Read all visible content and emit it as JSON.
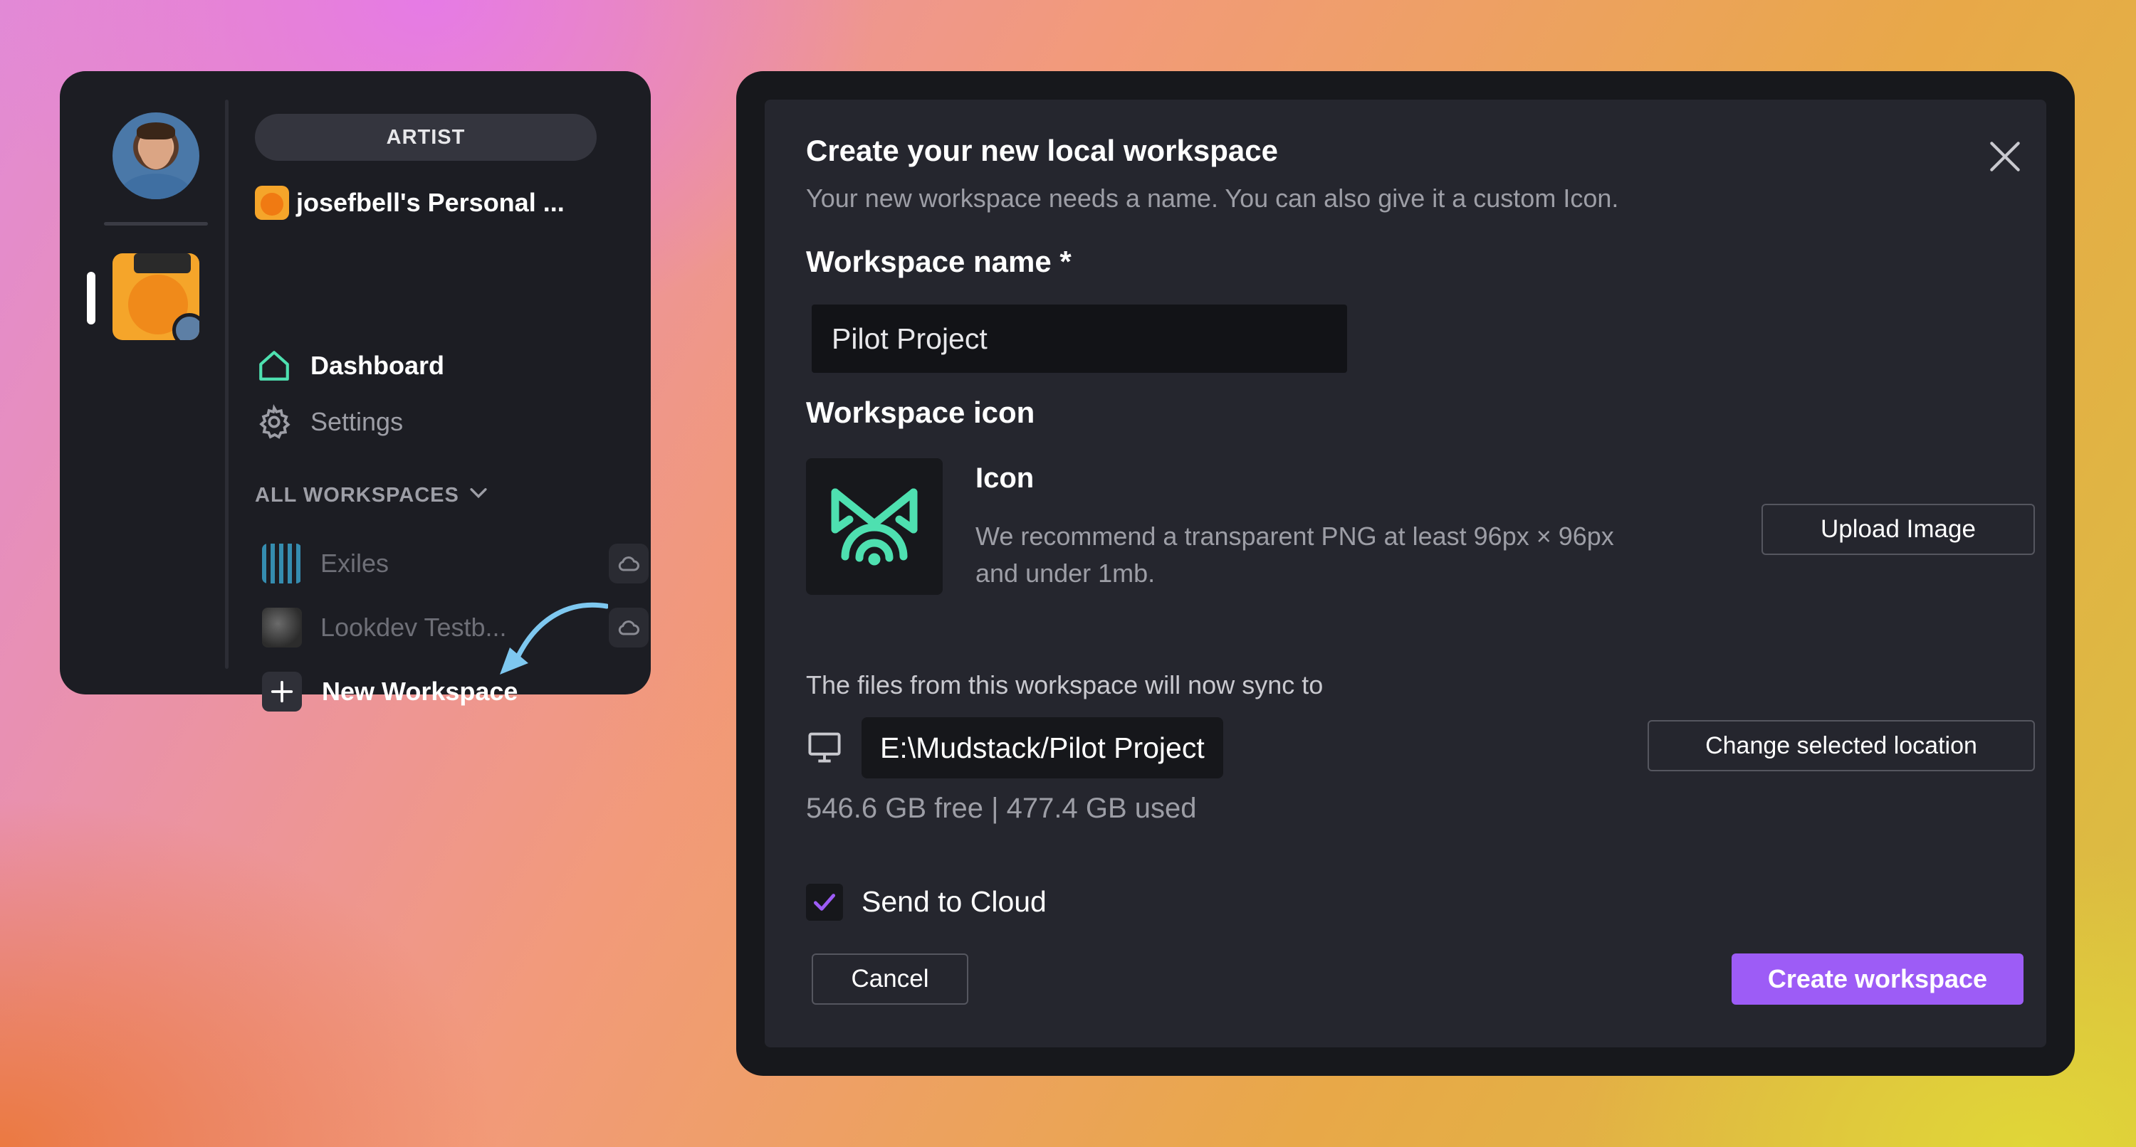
{
  "sidebar": {
    "role": "ARTIST",
    "account_name": "josefbell's Personal ...",
    "nav": {
      "dashboard": "Dashboard",
      "settings": "Settings"
    },
    "section_title": "ALL WORKSPACES",
    "workspaces": [
      {
        "label": "Exiles"
      },
      {
        "label": "Lookdev Testb..."
      }
    ],
    "new_workspace": "New Workspace",
    "accent_color": "#4ee0b0"
  },
  "modal": {
    "title": "Create your new local workspace",
    "subtitle": "Your new workspace needs a name. You can also give it a custom Icon.",
    "name_label": "Workspace name *",
    "name_value": "Pilot Project",
    "icon_label": "Workspace icon",
    "icon_heading": "Icon",
    "icon_description": "We recommend a transparent PNG at least 96px × 96px and under 1mb.",
    "upload_button": "Upload Image",
    "sync_text": "The files from this workspace will now sync to",
    "sync_path": "E:\\Mudstack/Pilot Project",
    "change_location_button": "Change selected location",
    "storage": "546.6 GB free | 477.4 GB used",
    "send_to_cloud_label": "Send to Cloud",
    "send_to_cloud_checked": true,
    "cancel_button": "Cancel",
    "create_button": "Create workspace",
    "primary_color": "#9d5cf6"
  }
}
